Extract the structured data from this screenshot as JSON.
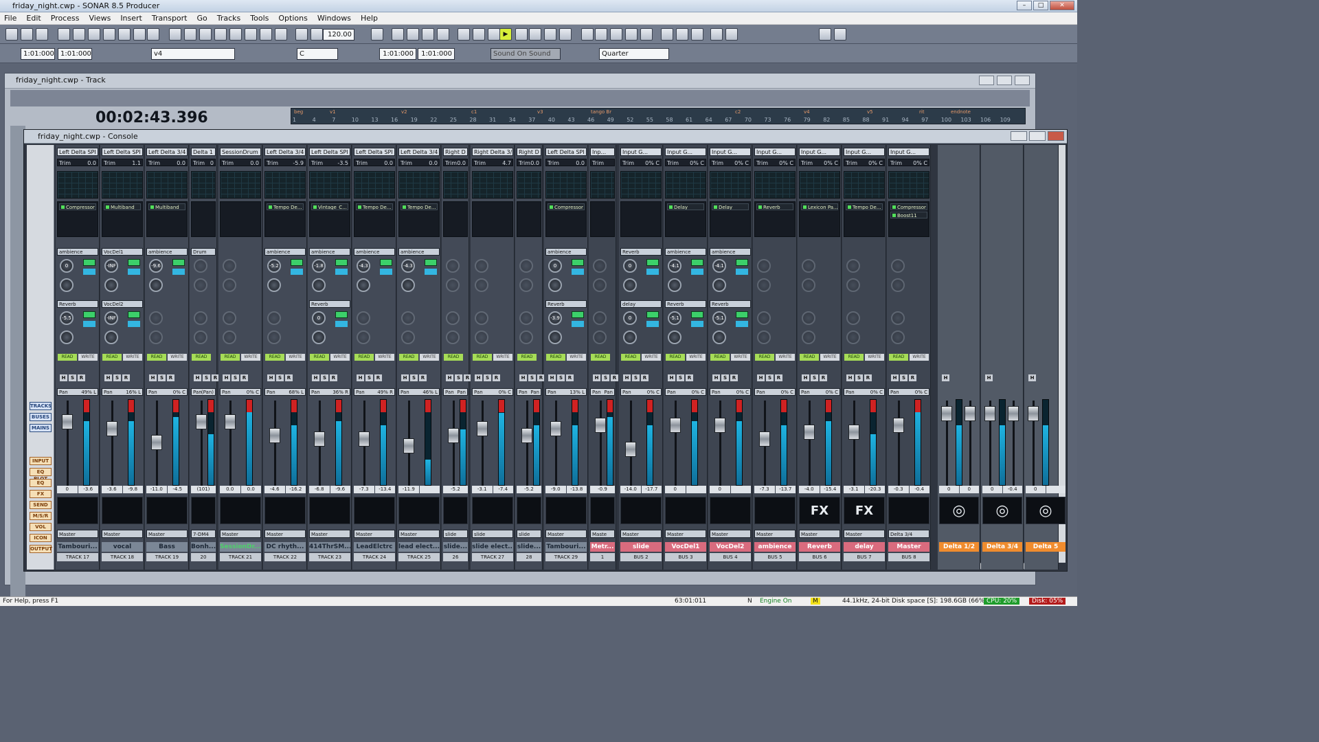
{
  "app": {
    "title": "friday_night.cwp - SONAR 8.5 Producer"
  },
  "menu": [
    "File",
    "Edit",
    "Process",
    "Views",
    "Insert",
    "Transport",
    "Go",
    "Tracks",
    "Tools",
    "Options",
    "Windows",
    "Help"
  ],
  "toolbar": {
    "tempo": "120.00",
    "time1": "1:01:000",
    "time2": "1:01:000",
    "track": "v4",
    "key": "C",
    "time3": "1:01:000",
    "time4": "1:01:000",
    "sound": "Sound On Sound",
    "snap": "Quarter"
  },
  "track_window": {
    "title": "friday_night.cwp - Track",
    "timecode": "00:02:43.396",
    "markers": [
      "beg",
      "v1",
      "v2",
      "c1",
      "v3",
      "tango Br",
      "c2",
      "v4",
      "v5",
      "rit",
      "endnote"
    ],
    "ruler": [
      "1",
      "4",
      "7",
      "10",
      "13",
      "16",
      "19",
      "22",
      "25",
      "28",
      "31",
      "34",
      "37",
      "40",
      "43",
      "46",
      "49",
      "52",
      "55",
      "58",
      "61",
      "64",
      "67",
      "70",
      "73",
      "76",
      "79",
      "82",
      "85",
      "88",
      "91",
      "94",
      "97",
      "100",
      "103",
      "106",
      "109"
    ]
  },
  "console": {
    "title": "friday_night.cwp - Console",
    "nav": [
      "TRACKS",
      "BUSES",
      "MAINS",
      "INPUT",
      "EQ PLOT",
      "EQ",
      "FX",
      "SEND",
      "M/S/R",
      "VOL",
      "ICON",
      "OUTPUT"
    ],
    "strips": [
      {
        "in": "Left Delta SPI",
        "trim": "0.0",
        "fx": [
          "Compressor"
        ],
        "s1": "ambience",
        "s1v": "0",
        "s2": "Reverb",
        "s2v": "-5.5",
        "pan": "49% L",
        "v1": "0",
        "v2": "-3.6",
        "img": "",
        "out": "Master",
        "name": "Tambouri...",
        "num": "TRACK 17",
        "fad": 0.2,
        "met": 0.75
      },
      {
        "in": "Left Delta SPI",
        "trim": "1.1",
        "fx": [
          "Multiband"
        ],
        "s1": "VocDel1",
        "s1v": "-INF",
        "s2": "VocDel2",
        "s2v": "-INF",
        "pan": "16% L",
        "v1": "-3.6",
        "v2": "-9.8",
        "img": "",
        "out": "Master",
        "name": "vocal",
        "num": "TRACK 18",
        "fad": 0.3,
        "met": 0.75
      },
      {
        "in": "Left Delta 3/4",
        "trim": "0.0",
        "fx": [
          "Multiband"
        ],
        "s1": "ambience",
        "s1v": "-9.6",
        "s2": "",
        "s2v": "",
        "pan": "0% C",
        "v1": "-11.0",
        "v2": "-4.5",
        "img": "",
        "out": "Master",
        "name": "Bass",
        "num": "TRACK 19",
        "fad": 0.5,
        "met": 0.8
      },
      {
        "in": "Delta 1",
        "trim": "0",
        "fx": [],
        "s1": "Drum",
        "s1v": "",
        "s2": "",
        "s2v": "",
        "pan": "(Pan)",
        "v1": "(101)",
        "v2": "",
        "img": "",
        "out": "7-DM4",
        "name": "Bonh...",
        "num": "20",
        "fad": 0.2,
        "met": 0.6
      },
      {
        "in": "SessionDrum",
        "trim": "0.0",
        "fx": [],
        "s1": "",
        "s1v": "",
        "s2": "",
        "s2v": "",
        "pan": "0% C",
        "v1": "0.0",
        "v2": "0.0",
        "img": "",
        "out": "Master",
        "name": "SessionDr...",
        "num": "TRACK 21",
        "fad": 0.2,
        "met": 0.9
      },
      {
        "in": "Left Delta 3/4",
        "trim": "-5.9",
        "fx": [
          "Tempo De..."
        ],
        "s1": "ambience",
        "s1v": "-5.2",
        "s2": "",
        "s2v": "",
        "pan": "68% L",
        "v1": "-4.6",
        "v2": "-16.2",
        "img": "",
        "out": "Master",
        "name": "DC rhyth...",
        "num": "TRACK 22",
        "fad": 0.4,
        "met": 0.7
      },
      {
        "in": "Left Delta SPI",
        "trim": "-3.5",
        "fx": [
          "Vintage_C..."
        ],
        "s1": "ambience",
        "s1v": "-1.8",
        "s2": "Reverb",
        "s2v": "0",
        "pan": "36% R",
        "v1": "-6.8",
        "v2": "-9.6",
        "img": "",
        "out": "Master",
        "name": "414ThrSM...",
        "num": "TRACK 23",
        "fad": 0.45,
        "met": 0.75
      },
      {
        "in": "Left Delta SPI",
        "trim": "0.0",
        "fx": [
          "Tempo De..."
        ],
        "s1": "ambience",
        "s1v": "-4.3",
        "s2": "",
        "s2v": "",
        "pan": "49% R",
        "v1": "-7.3",
        "v2": "-13.4",
        "img": "",
        "out": "Master",
        "name": "LeadElctrc",
        "num": "TRACK 24",
        "fad": 0.45,
        "met": 0.7
      },
      {
        "in": "Left Delta 3/4",
        "trim": "0.0",
        "fx": [
          "Tempo De..."
        ],
        "s1": "ambience",
        "s1v": "-4.3",
        "s2": "",
        "s2v": "",
        "pan": "46% L",
        "v1": "-11.9",
        "v2": "",
        "img": "",
        "out": "Master",
        "name": "lead elect...",
        "num": "TRACK 25",
        "fad": 0.55,
        "met": 0.3
      },
      {
        "in": "Right D",
        "trim": "0.0",
        "fx": [],
        "s1": "",
        "s1v": "",
        "s2": "",
        "s2v": "",
        "pan": "Pan",
        "v1": "-5.2",
        "v2": "",
        "img": "",
        "out": "slide",
        "name": "slide...",
        "num": "26",
        "fad": 0.4,
        "met": 0.65
      },
      {
        "in": "Right Delta 3/",
        "trim": "4.7",
        "fx": [],
        "s1": "",
        "s1v": "",
        "s2": "",
        "s2v": "",
        "pan": "0% C",
        "v1": "-3.1",
        "v2": "-7.4",
        "img": "",
        "out": "slide",
        "name": "slide elect...",
        "num": "TRACK 27",
        "fad": 0.3,
        "met": 0.85
      },
      {
        "in": "Right D",
        "trim": "0.0",
        "fx": [],
        "s1": "",
        "s1v": "",
        "s2": "",
        "s2v": "",
        "pan": "Pan",
        "v1": "-5.2",
        "v2": "",
        "img": "",
        "out": "slide",
        "name": "slide...",
        "num": "28",
        "fad": 0.4,
        "met": 0.7
      },
      {
        "in": "Left Delta SPI",
        "trim": "0.0",
        "fx": [
          "Compressor"
        ],
        "s1": "ambience",
        "s1v": "0",
        "s2": "Reverb",
        "s2v": "-3.9",
        "pan": "13% L",
        "v1": "-9.0",
        "v2": "-13.8",
        "img": "",
        "out": "Master",
        "name": "Tambouri...",
        "num": "TRACK 29",
        "fad": 0.3,
        "met": 0.7
      },
      {
        "in": "Inp...",
        "trim": "",
        "fx": [],
        "s1": "",
        "s1v": "",
        "s2": "",
        "s2v": "",
        "pan": "Pan",
        "v1": "-0.9",
        "v2": "",
        "img": "",
        "out": "Maste",
        "name": "Metr...",
        "num": "1",
        "fad": 0.25,
        "met": 0.8,
        "bus": true
      },
      {
        "in": "Input G...",
        "trim": "0% C",
        "fx": [],
        "s1": "Reverb",
        "s1v": "0",
        "s2": "delay",
        "s2v": "0",
        "pan": "0% C",
        "v1": "-14.0",
        "v2": "-17.7",
        "img": "",
        "out": "Master",
        "name": "slide",
        "num": "BUS 2",
        "fad": 0.6,
        "met": 0.7,
        "bus": true
      },
      {
        "in": "Input G...",
        "trim": "0% C",
        "fx": [
          "Delay"
        ],
        "s1": "ambience",
        "s1v": "-4.1",
        "s2": "Reverb",
        "s2v": "-5.1",
        "pan": "0% C",
        "v1": "0",
        "v2": "",
        "img": "",
        "out": "Master",
        "name": "VocDel1",
        "num": "BUS 3",
        "fad": 0.25,
        "met": 0.75,
        "bus": true
      },
      {
        "in": "Input G...",
        "trim": "0% C",
        "fx": [
          "Delay"
        ],
        "s1": "ambience",
        "s1v": "-4.1",
        "s2": "Reverb",
        "s2v": "-5.1",
        "pan": "0% C",
        "v1": "0",
        "v2": "",
        "img": "",
        "out": "Master",
        "name": "VocDel2",
        "num": "BUS 4",
        "fad": 0.25,
        "met": 0.75,
        "bus": true
      },
      {
        "in": "Input G...",
        "trim": "0% C",
        "fx": [
          "Reverb"
        ],
        "s1": "",
        "s1v": "",
        "s2": "",
        "s2v": "",
        "pan": "0% C",
        "v1": "-7.3",
        "v2": "-13.7",
        "img": "",
        "out": "Master",
        "name": "ambience",
        "num": "BUS 5",
        "fad": 0.45,
        "met": 0.7,
        "bus": true
      },
      {
        "in": "Input G...",
        "trim": "0% C",
        "fx": [
          "Lexicon Pa..."
        ],
        "s1": "",
        "s1v": "",
        "s2": "",
        "s2v": "",
        "pan": "0% C",
        "v1": "-4.0",
        "v2": "-15.4",
        "img": "FX",
        "out": "Master",
        "name": "Reverb",
        "num": "BUS 6",
        "fad": 0.35,
        "met": 0.75,
        "bus": true
      },
      {
        "in": "Input G...",
        "trim": "0% C",
        "fx": [
          "Tempo De..."
        ],
        "s1": "",
        "s1v": "",
        "s2": "",
        "s2v": "",
        "pan": "0% C",
        "v1": "-3.1",
        "v2": "-20.3",
        "img": "FX",
        "out": "Master",
        "name": "delay",
        "num": "BUS 7",
        "fad": 0.35,
        "met": 0.6,
        "bus": true
      },
      {
        "in": "Input G...",
        "trim": "0% C",
        "fx": [
          "Compressor",
          "Boost11"
        ],
        "s1": "",
        "s1v": "",
        "s2": "",
        "s2v": "",
        "pan": "0% C",
        "v1": "-0.3",
        "v2": "-0.4",
        "img": "",
        "out": "Delta 3/4",
        "name": "Master",
        "num": "BUS 8",
        "fad": 0.25,
        "met": 0.9,
        "bus": true
      }
    ],
    "mains": [
      {
        "name": "Delta 1/2",
        "v1": "0",
        "v2": "0"
      },
      {
        "name": "Delta 3/4",
        "v1": "0",
        "v2": "-0.4"
      },
      {
        "name": "Delta 5",
        "v1": "0",
        "v2": ""
      }
    ]
  },
  "status": {
    "help": "For Help, press F1",
    "pos": "63:01:011",
    "n": "N",
    "engine": "Engine On",
    "m": "M",
    "rate": "44.1kHz, 24-bit",
    "disk": "Disk space [S]: 198.6GB (66%)",
    "cpu": "CPU: 20%",
    "diskload": "Disk: 05%"
  },
  "colors": {
    "accent": "#d8f03a",
    "bus": "#d96b7e",
    "main": "#f08c2e",
    "lev": "#3cd06a"
  }
}
